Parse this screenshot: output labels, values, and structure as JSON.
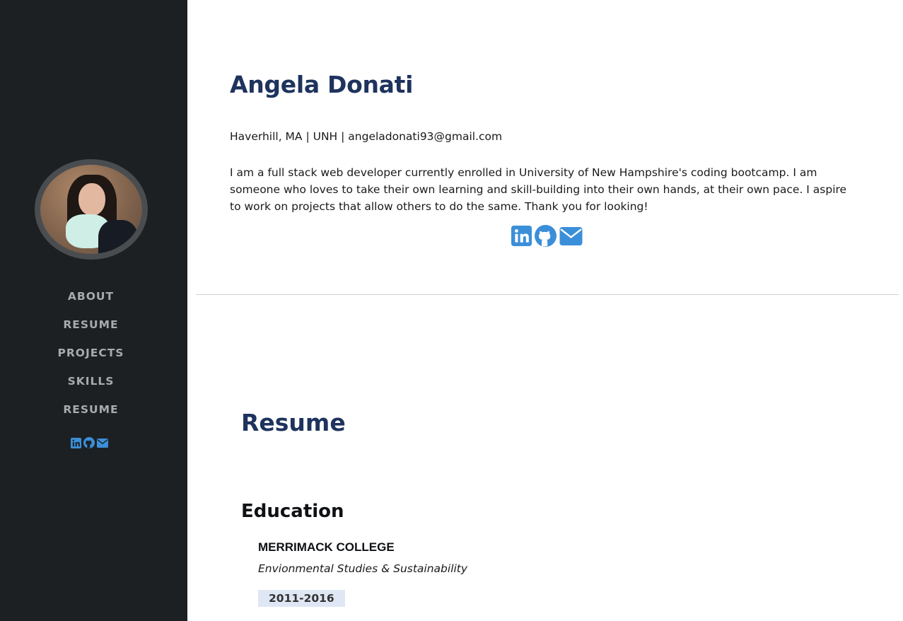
{
  "sidebar": {
    "nav": [
      {
        "label": "ABOUT"
      },
      {
        "label": "RESUME"
      },
      {
        "label": "PROJECTS"
      },
      {
        "label": "SKILLS"
      },
      {
        "label": "RESUME"
      }
    ],
    "social": [
      "linkedin-icon",
      "github-icon",
      "envelope-icon"
    ]
  },
  "about": {
    "name": "Angela Donati",
    "contact": "Haverhill, MA | UNH | angeladonati93@gmail.com",
    "bio": "I am a full stack web developer currently enrolled in University of New Hampshire's coding bootcamp. I am someone who loves to take their own learning and skill-building into their own hands, at their own pace. I aspire to work on projects that allow others to do the same. Thank you for looking!",
    "social": [
      "linkedin-icon",
      "github-icon",
      "envelope-icon"
    ]
  },
  "resume": {
    "title": "Resume",
    "education": {
      "heading": "Education",
      "school": "MERRIMACK COLLEGE",
      "degree": "Envionmental Studies & Sustainability",
      "years": "2011-2016"
    }
  },
  "colors": {
    "sidebar_bg": "#1d2023",
    "accent": "#3b8fd9",
    "heading": "#1e335d",
    "nav_text": "#a8aaad",
    "badge_bg": "#dfe6f4"
  }
}
